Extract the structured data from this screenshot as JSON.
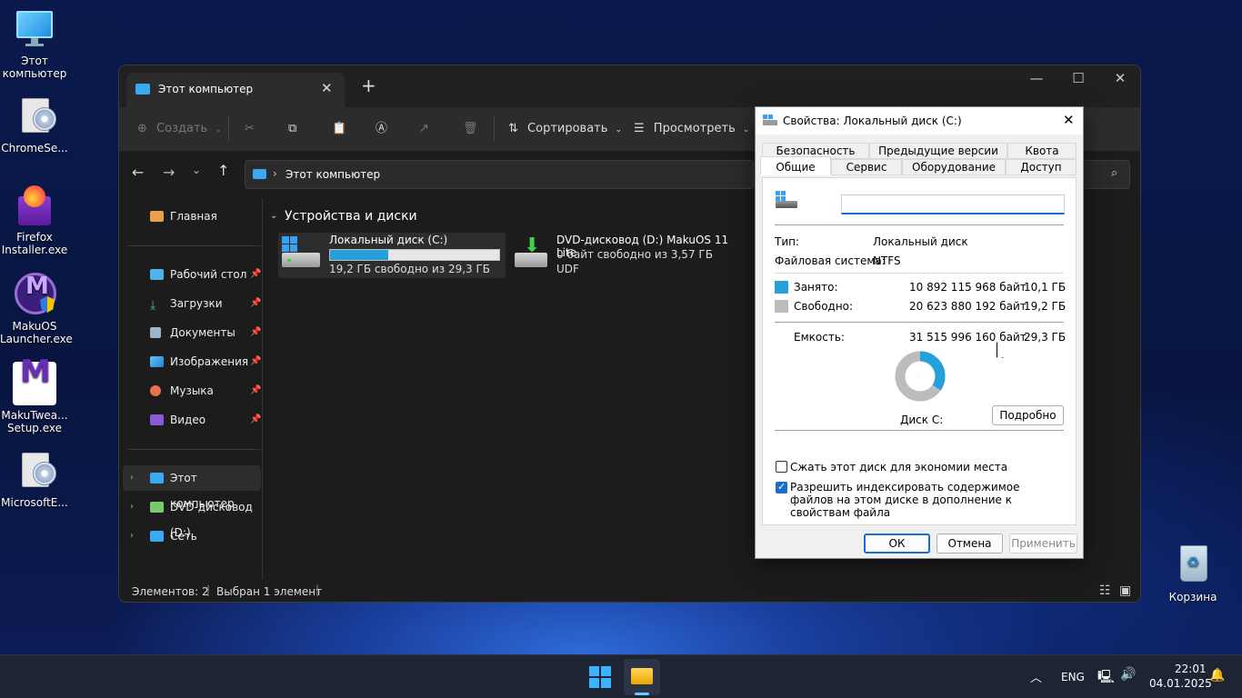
{
  "desktop": {
    "icons": [
      {
        "label": "Этот компьютер"
      },
      {
        "label": "ChromeSe..."
      },
      {
        "label": "Firefox Installer.exe"
      },
      {
        "label": "MakuOS Launcher.exe"
      },
      {
        "label": "MakuTwea... Setup.exe"
      },
      {
        "label": "MicrosoftE..."
      },
      {
        "label": "Корзина"
      }
    ]
  },
  "explorer": {
    "tab_title": "Этот компьютер",
    "toolbar": {
      "create": "Создать",
      "sort": "Сортировать",
      "view": "Просмотреть"
    },
    "address": {
      "path": "Этот компьютер"
    },
    "nav": {
      "home": "Главная",
      "quick": [
        {
          "label": "Рабочий стол"
        },
        {
          "label": "Загрузки"
        },
        {
          "label": "Документы"
        },
        {
          "label": "Изображения"
        },
        {
          "label": "Музыка"
        },
        {
          "label": "Видео"
        }
      ],
      "tree": [
        {
          "label": "Этот компьютер"
        },
        {
          "label": "DVD-дисковод (D:)"
        },
        {
          "label": "Сеть"
        }
      ]
    },
    "section_title": "Устройства и диски",
    "drives": [
      {
        "name": "Локальный диск (C:)",
        "free_text": "19,2 ГБ свободно из 29,3 ГБ",
        "used_fraction": 0.345
      },
      {
        "name": "DVD-дисковод (D:) MakuOS 11 Lite",
        "free_text": "0 байт свободно из 3,57 ГБ",
        "fs": "UDF"
      }
    ],
    "status": {
      "items": "Элементов: 2",
      "selected": "Выбран 1 элемент"
    }
  },
  "dialog": {
    "title": "Свойства: Локальный диск (C:)",
    "tabs_row1": [
      "Безопасность",
      "Предыдущие версии",
      "Квота"
    ],
    "tabs_row2": [
      "Общие",
      "Сервис",
      "Оборудование",
      "Доступ"
    ],
    "name_value": "",
    "type_label": "Тип:",
    "type_value": "Локальный диск",
    "fs_label": "Файловая система:",
    "fs_value": "NTFS",
    "used_label": "Занято:",
    "used_bytes": "10 892 115 968 байт",
    "used_size": "10,1 ГБ",
    "free_label": "Свободно:",
    "free_bytes": "20 623 880 192 байт",
    "free_size": "19,2 ГБ",
    "cap_label": "Емкость:",
    "cap_bytes": "31 515 996 160 байт",
    "cap_size": "29,3 ГБ",
    "disk_label": "Диск C:",
    "details_button": "Подробно",
    "compress_label": "Сжать этот диск для экономии места",
    "index_label": "Разрешить индексировать содержимое файлов на этом диске в дополнение к свойствам файла",
    "index_checked": true,
    "compress_checked": false,
    "ok": "ОК",
    "cancel": "Отмена",
    "apply": "Применить",
    "used_color": "#26a0da",
    "free_color": "#bcbcbc",
    "used_fraction": 0.3456
  },
  "taskbar": {
    "lang": "ENG",
    "time": "22:01",
    "date": "04.01.2025"
  }
}
